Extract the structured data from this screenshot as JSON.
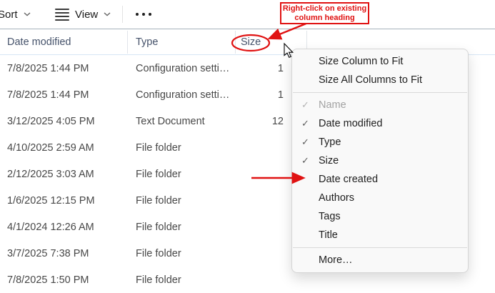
{
  "toolbar": {
    "sort_label": "Sort",
    "view_label": "View",
    "view_icon": "list-lines-icon",
    "more_icon": "ellipsis-icon",
    "chevron_icon": "chevron-down-icon"
  },
  "list": {
    "columns": [
      "Date modified",
      "Type",
      "Size"
    ],
    "rows": [
      {
        "date_modified": "7/8/2025 1:44 PM",
        "type": "Configuration setti…",
        "size": "1"
      },
      {
        "date_modified": "7/8/2025 1:44 PM",
        "type": "Configuration setti…",
        "size": "1"
      },
      {
        "date_modified": "3/12/2025 4:05 PM",
        "type": "Text Document",
        "size": "12"
      },
      {
        "date_modified": "4/10/2025 2:59 AM",
        "type": "File folder",
        "size": ""
      },
      {
        "date_modified": "2/12/2025 3:03 AM",
        "type": "File folder",
        "size": ""
      },
      {
        "date_modified": "1/6/2025 12:15 PM",
        "type": "File folder",
        "size": ""
      },
      {
        "date_modified": "4/1/2024 12:26 AM",
        "type": "File folder",
        "size": ""
      },
      {
        "date_modified": "3/7/2025 7:38 PM",
        "type": "File folder",
        "size": ""
      },
      {
        "date_modified": "7/8/2025 1:50 PM",
        "type": "File folder",
        "size": ""
      }
    ]
  },
  "context_menu": {
    "items": [
      {
        "label": "Size Column to Fit",
        "checked": false,
        "disabled": false
      },
      {
        "label": "Size All Columns to Fit",
        "checked": false,
        "disabled": false
      },
      {
        "label": "Name",
        "checked": true,
        "disabled": true
      },
      {
        "label": "Date modified",
        "checked": true,
        "disabled": false
      },
      {
        "label": "Type",
        "checked": true,
        "disabled": false
      },
      {
        "label": "Size",
        "checked": true,
        "disabled": false
      },
      {
        "label": "Date created",
        "checked": false,
        "disabled": false
      },
      {
        "label": "Authors",
        "checked": false,
        "disabled": false
      },
      {
        "label": "Tags",
        "checked": false,
        "disabled": false
      },
      {
        "label": "Title",
        "checked": false,
        "disabled": false
      },
      {
        "label": "More…",
        "checked": false,
        "disabled": false
      }
    ]
  },
  "annotations": {
    "callout_line1": "Right-click on existing",
    "callout_line2": "column heading",
    "circled_header": "Size",
    "arrow_target": "Date created"
  },
  "icons": {
    "check": "✓"
  },
  "colors": {
    "annotation_red": "#e01212",
    "menu_bg": "#f9f9f9",
    "header_text": "#46536b",
    "top_divider": "#a7b1bb",
    "header_underline": "#d7e6f5"
  }
}
